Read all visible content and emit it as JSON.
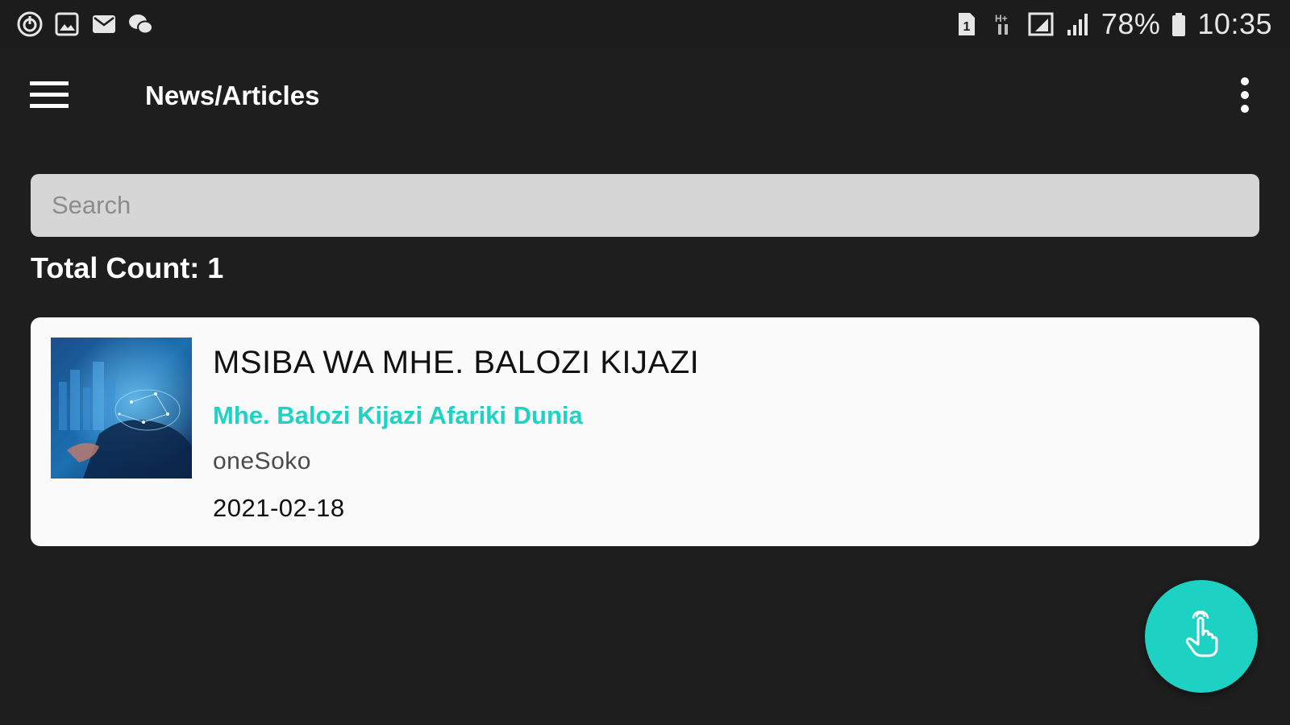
{
  "status_bar": {
    "left_icons": [
      "power-icon",
      "gallery-icon",
      "mail-icon",
      "wechat-icon"
    ],
    "right_icons": [
      "sim-icon",
      "data-arrows-icon",
      "cast-icon",
      "signal-icon",
      "battery-icon"
    ],
    "battery": "78%",
    "time": "10:35"
  },
  "app_bar": {
    "title": "News/Articles",
    "menu_icon": "hamburger-menu-icon",
    "overflow_icon": "more-vertical-icon"
  },
  "search": {
    "placeholder": "Search",
    "value": ""
  },
  "total_count": "Total Count: 1",
  "articles": [
    {
      "title": "MSIBA WA MHE. BALOZI KIJAZI",
      "subtitle": "Mhe. Balozi Kijazi Afariki Dunia",
      "source": "oneSoko",
      "date": "2021-02-18",
      "thumbnail": "globe-network-image"
    }
  ],
  "fab": {
    "icon": "touch-hand-icon"
  },
  "colors": {
    "background": "#1e1e1e",
    "accent": "#1dd2c2",
    "card": "#fafafa",
    "search_bg": "#d6d6d6"
  }
}
